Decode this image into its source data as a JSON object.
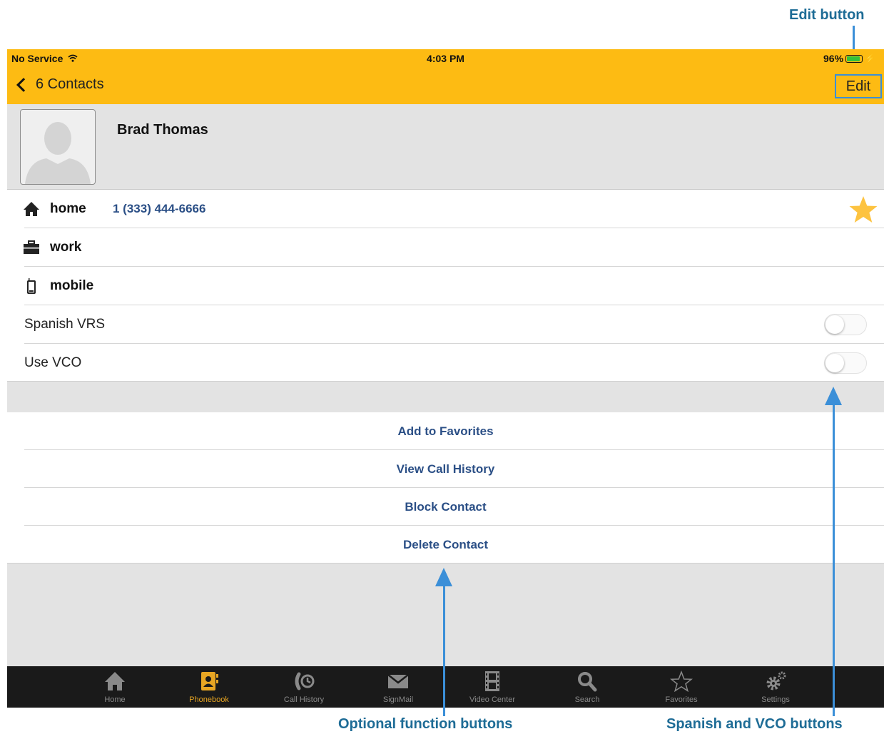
{
  "status_bar": {
    "carrier": "No Service",
    "time": "4:03 PM",
    "battery": "96%"
  },
  "nav": {
    "back_label": "6 Contacts",
    "edit_label": "Edit"
  },
  "contact": {
    "name": "Brad Thomas"
  },
  "numbers": [
    {
      "label": "home",
      "number": "1 (333) 444-6666",
      "icon": "home-icon",
      "favorite": true
    },
    {
      "label": "work",
      "number": "",
      "icon": "briefcase-icon"
    },
    {
      "label": "mobile",
      "number": "",
      "icon": "mobile-phone-icon"
    }
  ],
  "options": [
    {
      "label": "Spanish VRS",
      "enabled": false
    },
    {
      "label": "Use VCO",
      "enabled": false
    }
  ],
  "actions": [
    "Add to Favorites",
    "View Call History",
    "Block Contact",
    "Delete Contact"
  ],
  "tabs": [
    {
      "label": "Home",
      "icon": "home-icon"
    },
    {
      "label": "Phonebook",
      "icon": "phonebook-icon",
      "active": true
    },
    {
      "label": "Call History",
      "icon": "call-history-icon"
    },
    {
      "label": "SignMail",
      "icon": "envelope-icon"
    },
    {
      "label": "Video Center",
      "icon": "film-icon"
    },
    {
      "label": "Search",
      "icon": "search-icon"
    },
    {
      "label": "Favorites",
      "icon": "star-icon"
    },
    {
      "label": "Settings",
      "icon": "gear-icon"
    }
  ],
  "annotations": {
    "edit": "Edit button",
    "optional": "Optional function buttons",
    "spanish_vco": "Spanish and VCO buttons"
  },
  "colors": {
    "accent": "#fdbb13",
    "link": "#2b4f86",
    "annotation": "#3b8fd8",
    "tab_active": "#e8a623"
  }
}
